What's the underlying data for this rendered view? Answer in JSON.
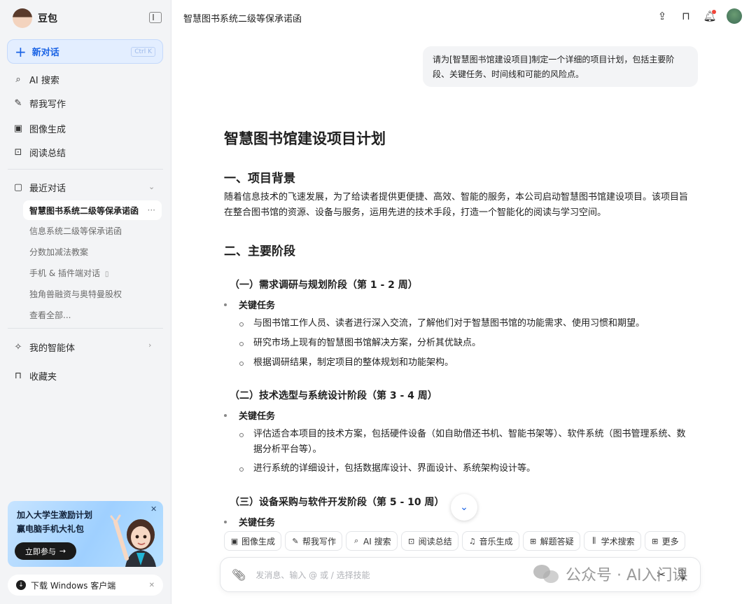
{
  "sidebar": {
    "brand": "豆包",
    "new_chat": {
      "label": "新对话",
      "shortcut": "Ctrl K"
    },
    "nav": [
      {
        "label": "AI 搜索",
        "icon": "search-sparkle-icon"
      },
      {
        "label": "帮我写作",
        "icon": "pen-icon"
      },
      {
        "label": "图像生成",
        "icon": "image-icon"
      },
      {
        "label": "阅读总结",
        "icon": "book-icon"
      }
    ],
    "recent_header": "最近对话",
    "recent": [
      "智慧图书系统二级等保承诺函",
      "信息系统二级等保承诺函",
      "分数加减法教案",
      "手机 & 插件端对话",
      "独角兽融资与奥特曼股权",
      "查看全部..."
    ],
    "agents": "我的智能体",
    "favorites": "收藏夹",
    "promo": {
      "line1": "加入大学生激励计划",
      "line2": "赢电脑手机大礼包",
      "button": "立即参与"
    },
    "download": "下载 Windows 客户端"
  },
  "header": {
    "title": "智慧图书系统二级等保承诺函"
  },
  "conversation": {
    "user_message": "请为[智慧图书馆建设项目]制定一个详细的项目计划，包括主要阶段、关键任务、时间线和可能的风险点。",
    "doc": {
      "title": "智慧图书馆建设项目计划",
      "s1_heading": "一、项目背景",
      "s1_text": "随着信息技术的飞速发展，为了给读者提供更便捷、高效、智能的服务，本公司启动智慧图书馆建设项目。该项目旨在整合图书馆的资源、设备与服务，运用先进的技术手段，打造一个智能化的阅读与学习空间。",
      "s2_heading": "二、主要阶段",
      "p1_heading": "（一）需求调研与规划阶段（第 1 - 2 周）",
      "p1_bullet": "关键任务",
      "p1_tasks": [
        "与图书馆工作人员、读者进行深入交流，了解他们对于智慧图书馆的功能需求、使用习惯和期望。",
        "研究市场上现有的智慧图书馆解决方案，分析其优缺点。",
        "根据调研结果，制定项目的整体规划和功能架构。"
      ],
      "p2_heading": "（二）技术选型与系统设计阶段（第 3 - 4 周）",
      "p2_bullet": "关键任务",
      "p2_tasks": [
        "评估适合本项目的技术方案，包括硬件设备（如自助借还书机、智能书架等）、软件系统（图书管理系统、数据分析平台等）。",
        "进行系统的详细设计，包括数据库设计、界面设计、系统架构设计等。"
      ],
      "p3_heading": "（三）设备采购与软件开发阶段（第 5 - 10 周）",
      "p3_bullet": "关键任务"
    }
  },
  "skills": [
    "图像生成",
    "帮我写作",
    "AI 搜索",
    "阅读总结",
    "音乐生成",
    "解题答疑",
    "学术搜索",
    "更多"
  ],
  "input": {
    "placeholder": "发消息、输入 @ 或 / 选择技能"
  },
  "watermark": "公众号 · AI入门课"
}
